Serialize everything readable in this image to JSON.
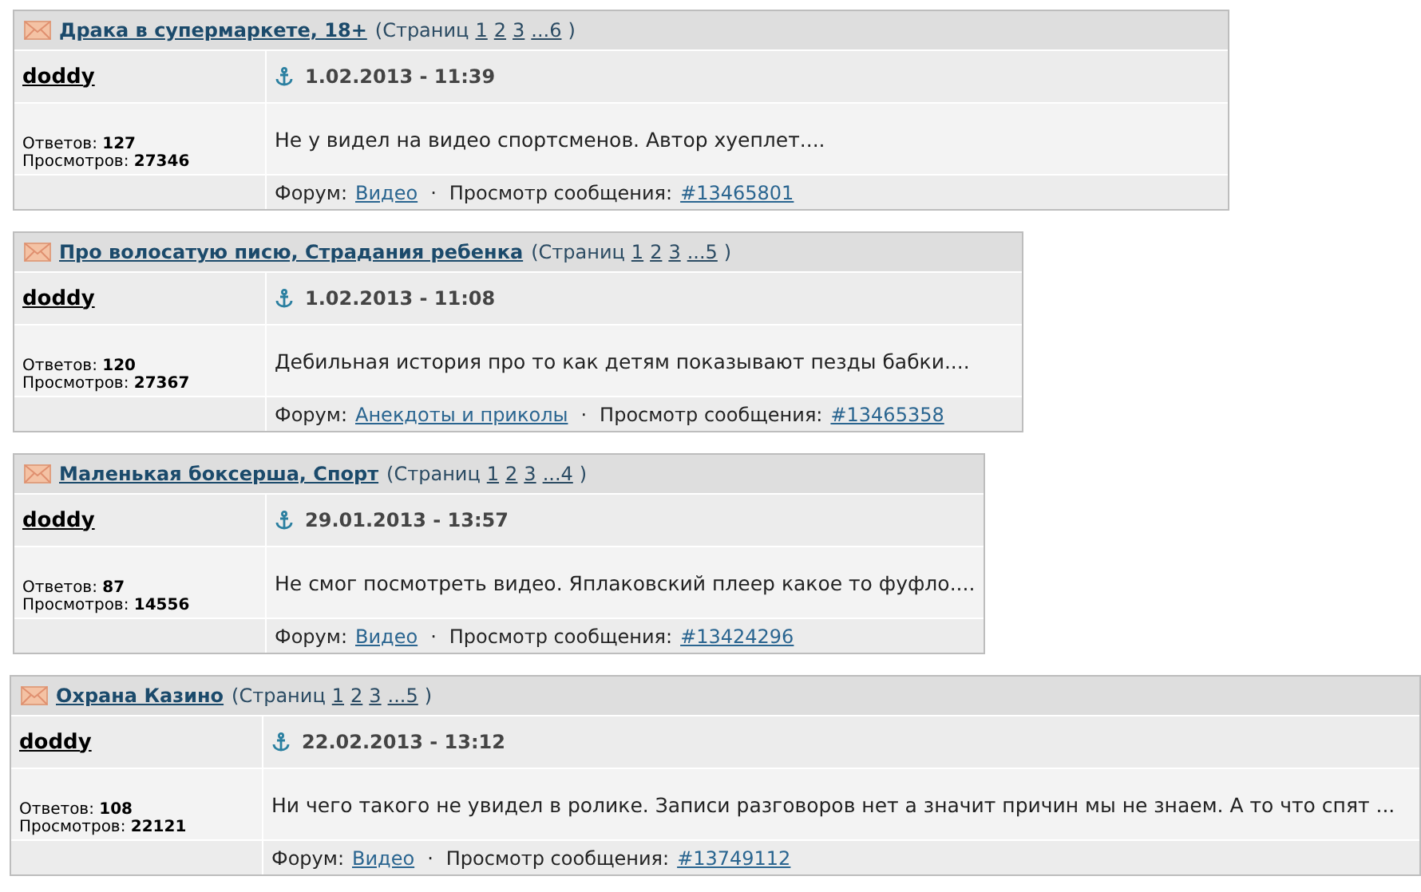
{
  "topics": [
    {
      "title": "Драка в супермаркете, 18+",
      "pages_prefix": "(Страниц",
      "pages": [
        "1",
        "2",
        "3",
        "...6"
      ],
      "pages_suffix": ")",
      "author": "doddy",
      "date": "1.02.2013 - 11:39",
      "replies_label": "Ответов:",
      "replies": "127",
      "views_label": "Просмотров:",
      "views": "27346",
      "message": "Не у видел на видео спортсменов. Автор хуеплет....",
      "forum_label": "Форум:",
      "forum": "Видео",
      "separator": "·",
      "post_label": "Просмотр сообщения:",
      "post": "#13465801"
    },
    {
      "title": "Про волосатую писю, Страдания ребенка",
      "pages_prefix": "(Страниц",
      "pages": [
        "1",
        "2",
        "3",
        "...5"
      ],
      "pages_suffix": ")",
      "author": "doddy",
      "date": "1.02.2013 - 11:08",
      "replies_label": "Ответов:",
      "replies": "120",
      "views_label": "Просмотров:",
      "views": "27367",
      "message": "Дебильная история про то как детям показывают пезды бабки....",
      "forum_label": "Форум:",
      "forum": "Анекдоты и приколы",
      "separator": "·",
      "post_label": "Просмотр сообщения:",
      "post": "#13465358"
    },
    {
      "title": "Маленькая боксерша, Спорт",
      "pages_prefix": "(Страниц",
      "pages": [
        "1",
        "2",
        "3",
        "...4"
      ],
      "pages_suffix": ")",
      "author": "doddy",
      "date": "29.01.2013 - 13:57",
      "replies_label": "Ответов:",
      "replies": "87",
      "views_label": "Просмотров:",
      "views": "14556",
      "message": "Не смог посмотреть видео. Яплаковский плеер какое то фуфло....",
      "forum_label": "Форум:",
      "forum": "Видео",
      "separator": "·",
      "post_label": "Просмотр сообщения:",
      "post": "#13424296"
    },
    {
      "title": "Охрана Казино",
      "pages_prefix": "(Страниц",
      "pages": [
        "1",
        "2",
        "3",
        "...5"
      ],
      "pages_suffix": ")",
      "author": "doddy",
      "date": "22.02.2013 - 13:12",
      "replies_label": "Ответов:",
      "replies": "108",
      "views_label": "Просмотров:",
      "views": "22121",
      "message": "Ни чего такого не увидел в ролике. Записи разговоров нет а значит причин мы не знаем. А то что спят ...",
      "forum_label": "Форум:",
      "forum": "Видео",
      "separator": "·",
      "post_label": "Просмотр сообщения:",
      "post": "#13749112"
    }
  ]
}
